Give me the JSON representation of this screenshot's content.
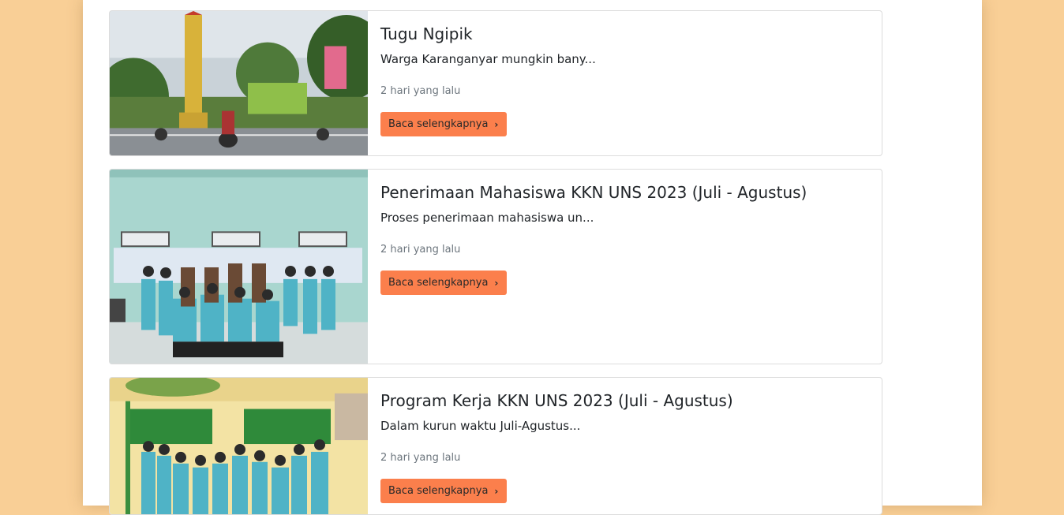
{
  "posts": [
    {
      "title": "Tugu Ngipik",
      "excerpt": "Warga Karanganyar mungkin bany...",
      "time": "2 hari yang lalu",
      "button": "Baca selengkapnya",
      "button_icon": "chevron-right-icon"
    },
    {
      "title": "Penerimaan Mahasiswa KKN UNS 2023 (Juli - Agustus)",
      "excerpt": "Proses penerimaan mahasiswa un...",
      "time": "2 hari yang lalu",
      "button": "Baca selengkapnya",
      "button_icon": "chevron-right-icon"
    },
    {
      "title": "Program Kerja KKN UNS 2023 (Juli - Agustus)",
      "excerpt": "Dalam kurun waktu Juli-Agustus...",
      "time": "2 hari yang lalu",
      "button": "Baca selengkapnya",
      "button_icon": "chevron-right-icon"
    }
  ],
  "colors": {
    "background": "#f9cf96",
    "button": "#fb7f4c",
    "muted_text": "#6c757d"
  }
}
